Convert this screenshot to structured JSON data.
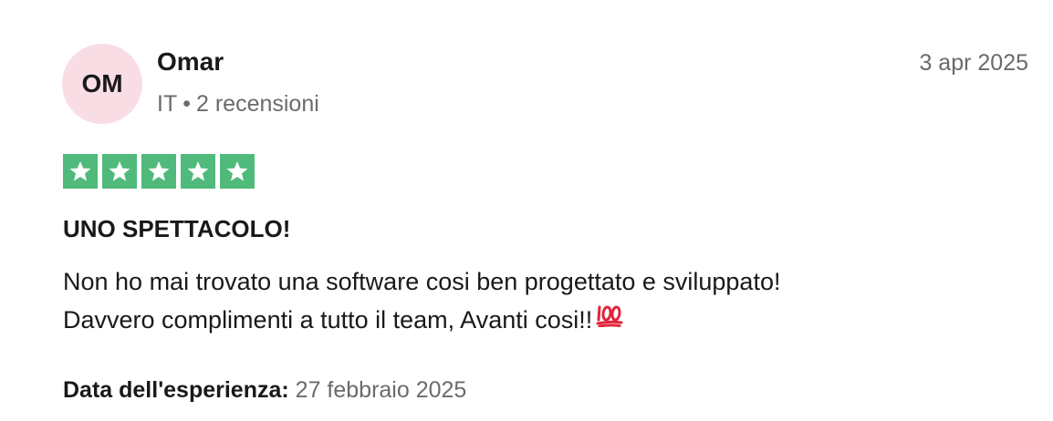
{
  "reviewer": {
    "initials": "OM",
    "name": "Omar",
    "country": "IT",
    "separator": "•",
    "reviews_count": "2 recensioni"
  },
  "review": {
    "date": "3 apr 2025",
    "rating": 5,
    "rating_max": 5,
    "title": "UNO SPETTACOLO!",
    "body_lines": [
      "Non ho mai trovato una software cosi ben progettato e sviluppato!",
      "Davvero complimenti a tutto il team, Avanti cosi!!"
    ],
    "emoji": "hundred-points-icon",
    "experience_label": "Data dell'esperienza:",
    "experience_date": "27 febbraio 2025"
  },
  "colors": {
    "star_green": "#4fba7c",
    "avatar_bg": "#f8dde4",
    "emoji_red": "#e0243a"
  }
}
